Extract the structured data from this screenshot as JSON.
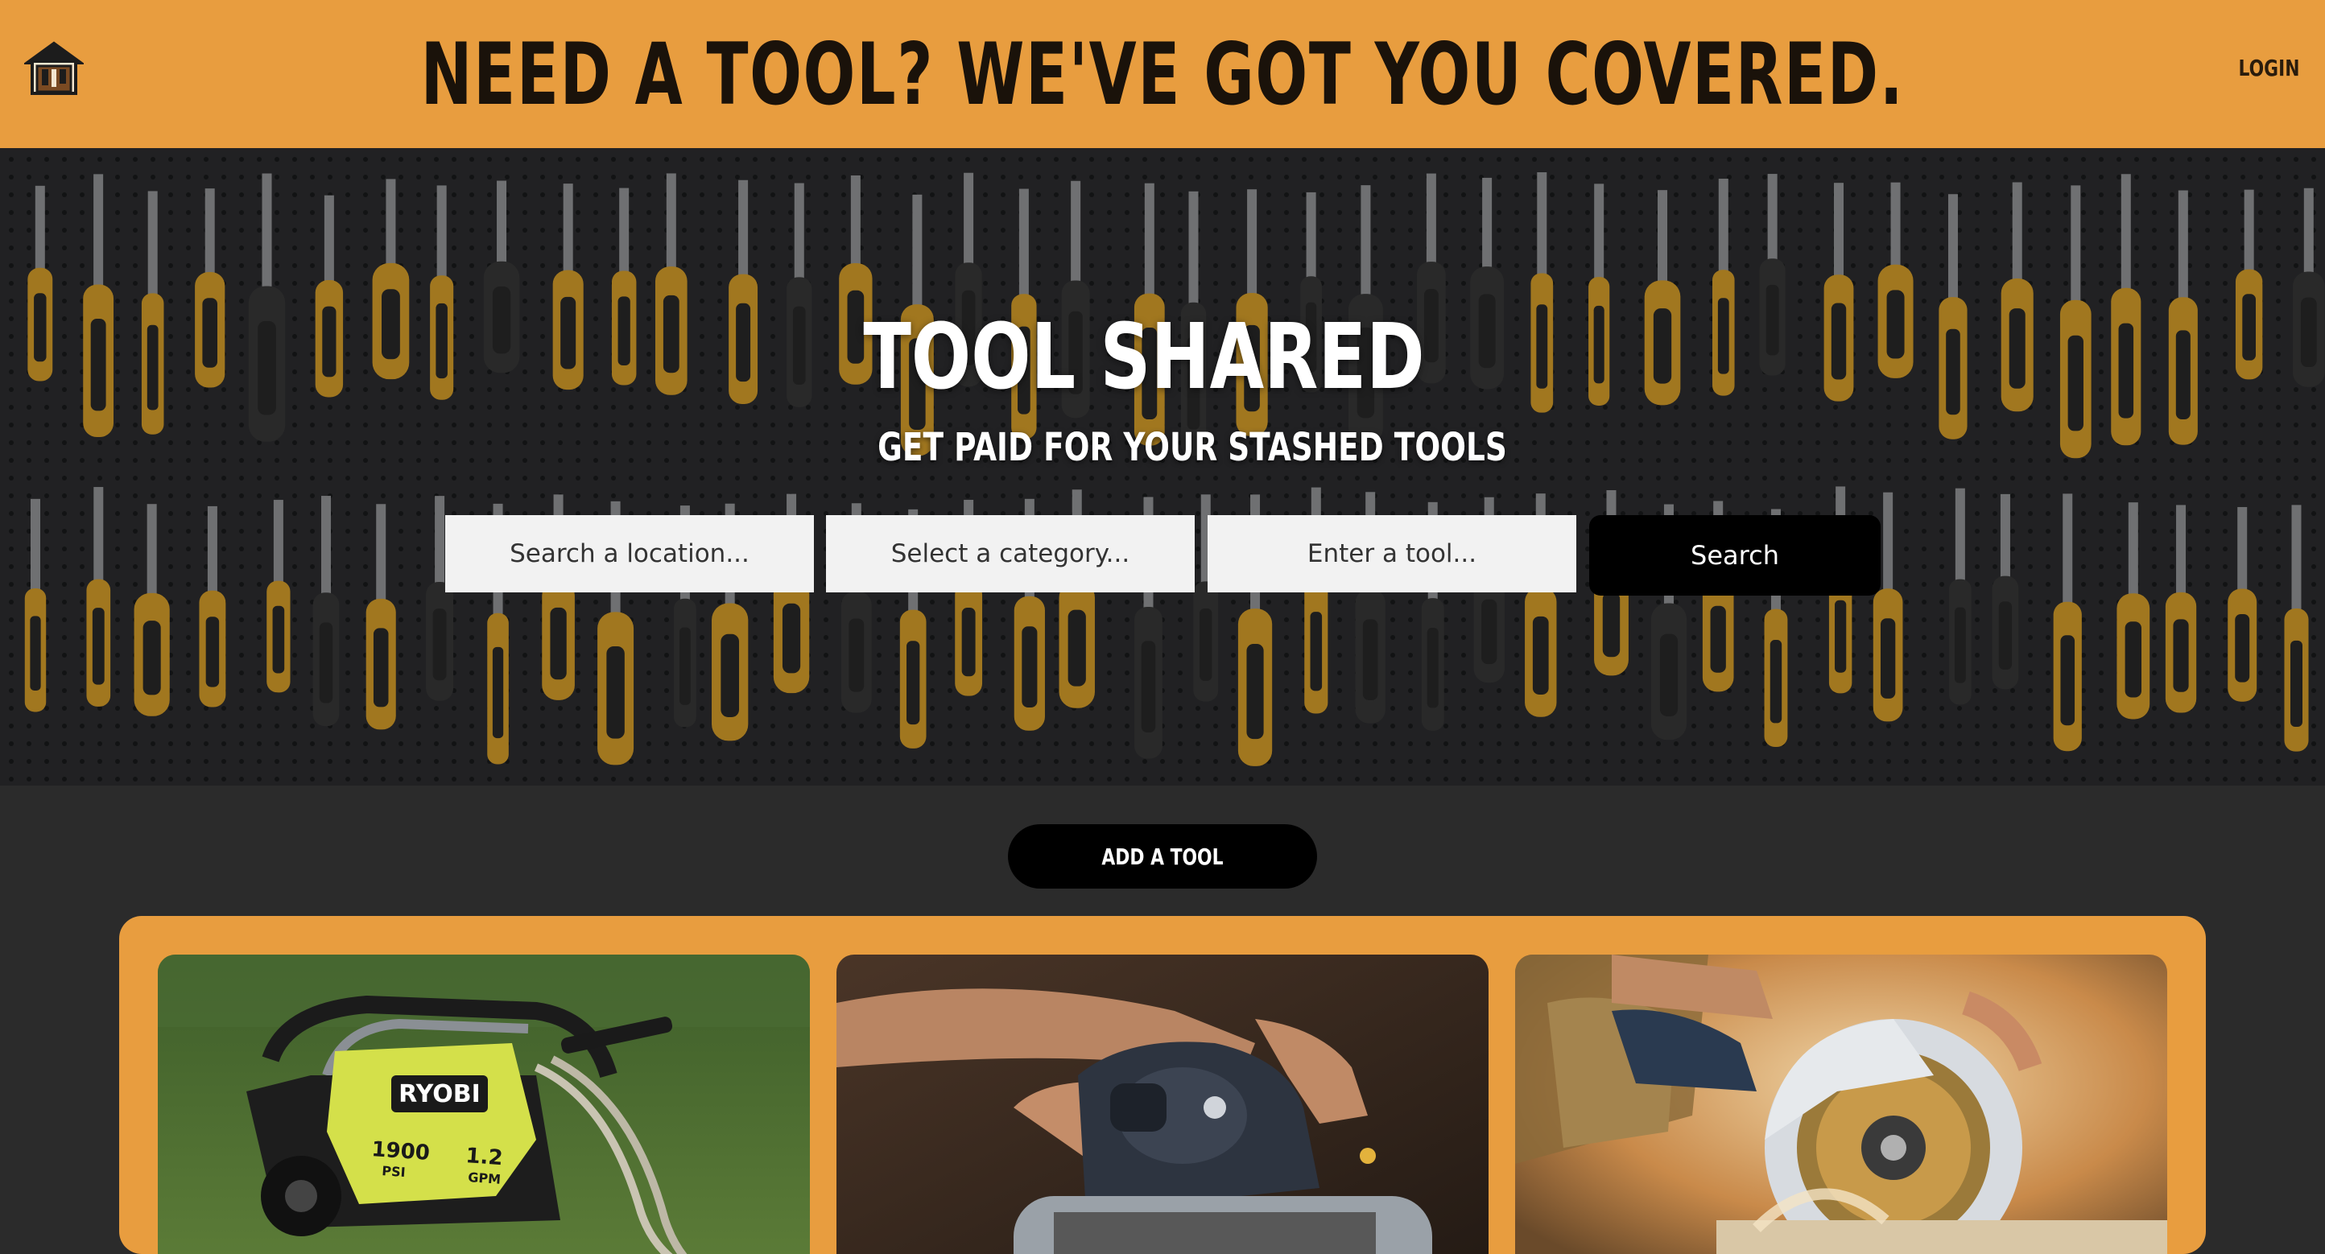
{
  "header": {
    "headline": "NEED A TOOL? WE'VE GOT YOU COVERED.",
    "login_label": "LOGIN",
    "logo_icon": "tool-shed-icon"
  },
  "hero": {
    "title": "TOOL SHARED",
    "subtitle": "GET PAID FOR YOUR STASHED TOOLS",
    "background": "pegboard-of-tools-photo",
    "search": {
      "location_placeholder": "Search a location...",
      "category_placeholder": "Select a category...",
      "tool_placeholder": "Enter a tool...",
      "button_label": "Search"
    }
  },
  "actions": {
    "add_tool_label": "ADD A TOOL"
  },
  "listings": [
    {
      "image": "pressure-washer-photo",
      "brand": "RYOBI",
      "psi": "1900",
      "psi_unit": "PSI",
      "gpm": "1.2",
      "gpm_unit": "GPM"
    },
    {
      "image": "belt-sander-photo"
    },
    {
      "image": "circular-saw-photo"
    }
  ],
  "colors": {
    "accent": "#e89d3f",
    "background": "#2b2b2b",
    "button": "#000000",
    "tool_handle": "#e0a52c"
  }
}
